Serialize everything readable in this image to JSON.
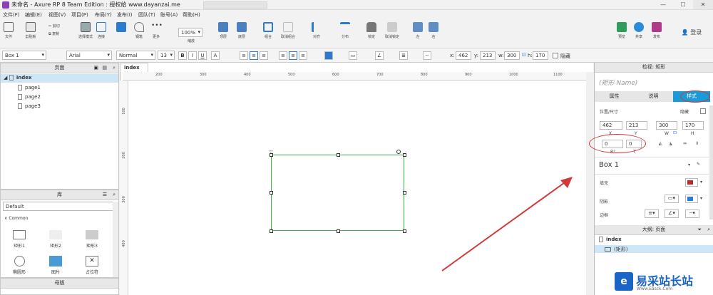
{
  "window": {
    "title": "未命名 - Axure RP 8 Team Edition : 授权给 www.dayanzai.me",
    "minimize": "—",
    "maximize": "☐",
    "close": "✕"
  },
  "menu": [
    "文件(F)",
    "编辑(E)",
    "视图(V)",
    "项目(P)",
    "布局(Y)",
    "发布(I)",
    "团队(T)",
    "账号(A)",
    "帮助(H)"
  ],
  "toolbar": {
    "file": "文件",
    "clipboard": "剪贴板",
    "cut": "剪切",
    "copy": "复制",
    "select_mode": "选择模式",
    "connect": "连接",
    "pen": "钢笔",
    "more": "更多",
    "zoom_value": "100%",
    "zoom_label": "缩放",
    "top": "顶层",
    "bottom": "底层",
    "group": "组合",
    "ungroup": "取消组合",
    "align": "对齐",
    "distribute": "分布",
    "lock": "锁定",
    "unlock": "取消锁定",
    "left": "左",
    "right": "右",
    "preview": "预览",
    "share": "共享",
    "publish": "发布",
    "login": "登录"
  },
  "format": {
    "style": "Box 1",
    "font": "Arial",
    "weight": "Normal",
    "size": "13",
    "x_label": "x:",
    "x": "462",
    "y_label": "y:",
    "y": "213",
    "w_label": "w:",
    "w": "300",
    "h_label": "h:",
    "h": "170",
    "hidden": "隐藏"
  },
  "pages_panel": {
    "title": "页面",
    "root": "index",
    "pages": [
      "page1",
      "page2",
      "page3"
    ]
  },
  "library_panel": {
    "title": "库",
    "selected": "Default",
    "group": "Common",
    "items": [
      "矩形1",
      "矩形2",
      "矩形3",
      "椭圆形",
      "图片",
      "占位符"
    ]
  },
  "masters_panel": {
    "title": "母版"
  },
  "canvas": {
    "tab": "index",
    "ruler_h": [
      "200",
      "300",
      "400",
      "500",
      "600",
      "700",
      "800",
      "900",
      "1000",
      "1100"
    ],
    "ruler_v": [
      "100",
      "200",
      "300",
      "400"
    ]
  },
  "inspector": {
    "title": "检视: 矩形",
    "name_placeholder": "(矩形 Name)",
    "tabs": [
      "属性",
      "说明",
      "样式"
    ],
    "active_tab": "样式",
    "position_label": "位置/尺寸",
    "hidden": "隐藏",
    "x": "462",
    "y": "213",
    "w": "300",
    "h": "170",
    "x_label": "X",
    "y_label": "Y",
    "w_label": "W",
    "h_label": "H",
    "r": "0",
    "t": "0",
    "r_label": "R°",
    "t_label": "T",
    "style_name": "Box 1",
    "fill": "填充",
    "shadow": "阴影",
    "border": "边框",
    "fill_color": "#c0282d",
    "shadow_color": "#2b7bd1"
  },
  "outline_panel": {
    "title": "大纲: 页面",
    "root": "index",
    "child": "(矩形)"
  },
  "watermark": {
    "brand": "易采站长站",
    "url": "Www.Easck.Com"
  },
  "colors": {
    "accent": "#1a9ad6",
    "annotation": "#d03a3a",
    "selection": "#43b043"
  }
}
